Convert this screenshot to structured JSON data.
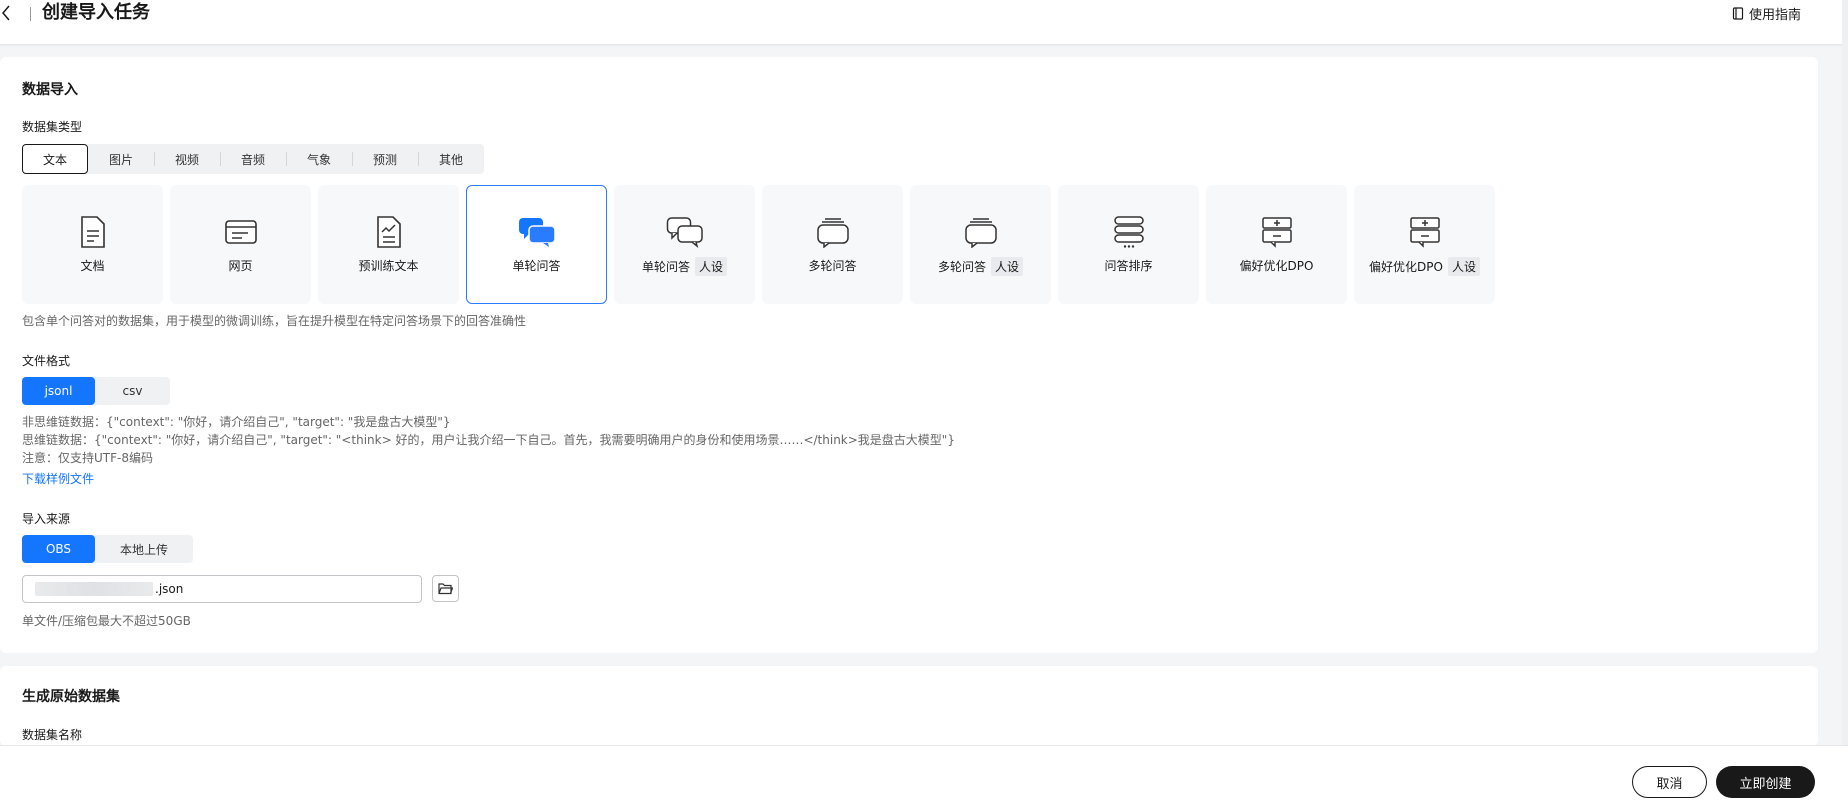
{
  "header": {
    "title": "创建导入任务",
    "guide": "使用指南"
  },
  "import_section": {
    "title": "数据导入",
    "dataset_type_label": "数据集类型",
    "tabs": [
      "文本",
      "图片",
      "视频",
      "音频",
      "气象",
      "预测",
      "其他"
    ],
    "active_tab": "文本",
    "cards": [
      {
        "label": "文档",
        "tag": "",
        "icon": "document-icon"
      },
      {
        "label": "网页",
        "tag": "",
        "icon": "webpage-icon"
      },
      {
        "label": "预训练文本",
        "tag": "",
        "icon": "pretrain-text-icon"
      },
      {
        "label": "单轮问答",
        "tag": "",
        "icon": "single-qa-icon"
      },
      {
        "label": "单轮问答",
        "tag": "人设",
        "icon": "single-qa-persona-icon"
      },
      {
        "label": "多轮问答",
        "tag": "",
        "icon": "multi-qa-icon"
      },
      {
        "label": "多轮问答",
        "tag": "人设",
        "icon": "multi-qa-persona-icon"
      },
      {
        "label": "问答排序",
        "tag": "",
        "icon": "qa-ranking-icon"
      },
      {
        "label": "偏好优化DPO",
        "tag": "",
        "icon": "dpo-icon"
      },
      {
        "label": "偏好优化DPO",
        "tag": "人设",
        "icon": "dpo-persona-icon"
      }
    ],
    "selected_card": "单轮问答",
    "card_description": "包含单个问答对的数据集，用于模型的微调训练，旨在提升模型在特定问答场景下的回答准确性",
    "file_format_label": "文件格式",
    "formats": [
      "jsonl",
      "csv"
    ],
    "active_format": "jsonl",
    "example_lines": [
      "非思维链数据：{\"context\": \"你好，请介绍自己\", \"target\": \"我是盘古大模型\"}",
      "思维链数据：{\"context\": \"你好，请介绍自己\", \"target\": \"<think> 好的，用户让我介绍一下自己。首先，我需要明确用户的身份和使用场景……</think>我是盘古大模型\"}",
      "注意：仅支持UTF-8编码"
    ],
    "download_link": "下载样例文件",
    "source_label": "导入来源",
    "sources": [
      "OBS",
      "本地上传"
    ],
    "active_source": "OBS",
    "path_value": ".json",
    "size_hint": "单文件/压缩包最大不超过50GB"
  },
  "generate_section": {
    "title": "生成原始数据集",
    "name_label": "数据集名称"
  },
  "footer": {
    "cancel": "取消",
    "create": "立即创建"
  },
  "colors": {
    "accent": "#1476ff",
    "dark_button": "#191919"
  }
}
